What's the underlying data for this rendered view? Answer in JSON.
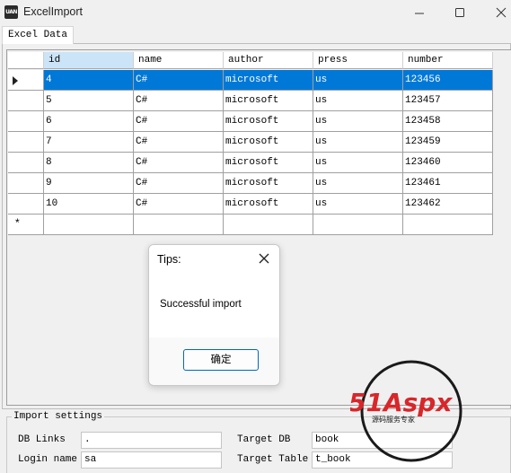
{
  "window": {
    "icon_text": "UAN",
    "title": "ExcelImport"
  },
  "tabs": [
    {
      "label": "Excel Data"
    }
  ],
  "grid": {
    "columns": [
      "id",
      "name",
      "author",
      "press",
      "number"
    ],
    "selected_column": "id",
    "rows": [
      [
        "4",
        "C#",
        "microsoft",
        "us",
        "123456"
      ],
      [
        "5",
        "C#",
        "microsoft",
        "us",
        "123457"
      ],
      [
        "6",
        "C#",
        "microsoft",
        "us",
        "123458"
      ],
      [
        "7",
        "C#",
        "microsoft",
        "us",
        "123459"
      ],
      [
        "8",
        "C#",
        "microsoft",
        "us",
        "123460"
      ],
      [
        "9",
        "C#",
        "microsoft",
        "us",
        "123461"
      ],
      [
        "10",
        "C#",
        "microsoft",
        "us",
        "123462"
      ]
    ],
    "new_row_marker": "*"
  },
  "dialog": {
    "title": "Tips:",
    "message": "Successful import",
    "ok_label": "确定"
  },
  "import_settings": {
    "legend": "Import settings",
    "db_links_label": "DB Links",
    "db_links_value": ".",
    "login_name_label": "Login name",
    "login_name_value": "sa",
    "target_db_label": "Target DB",
    "target_db_value": "book",
    "target_table_label": "Target Table",
    "target_table_value": "t_book"
  },
  "watermark": {
    "text": "51Aspx",
    "subtitle": "源码服务专家"
  },
  "colors": {
    "selection": "#0078d7",
    "header_selected": "#cce4f7",
    "watermark_red": "#d8262a",
    "watermark_green": "#2ea043"
  }
}
